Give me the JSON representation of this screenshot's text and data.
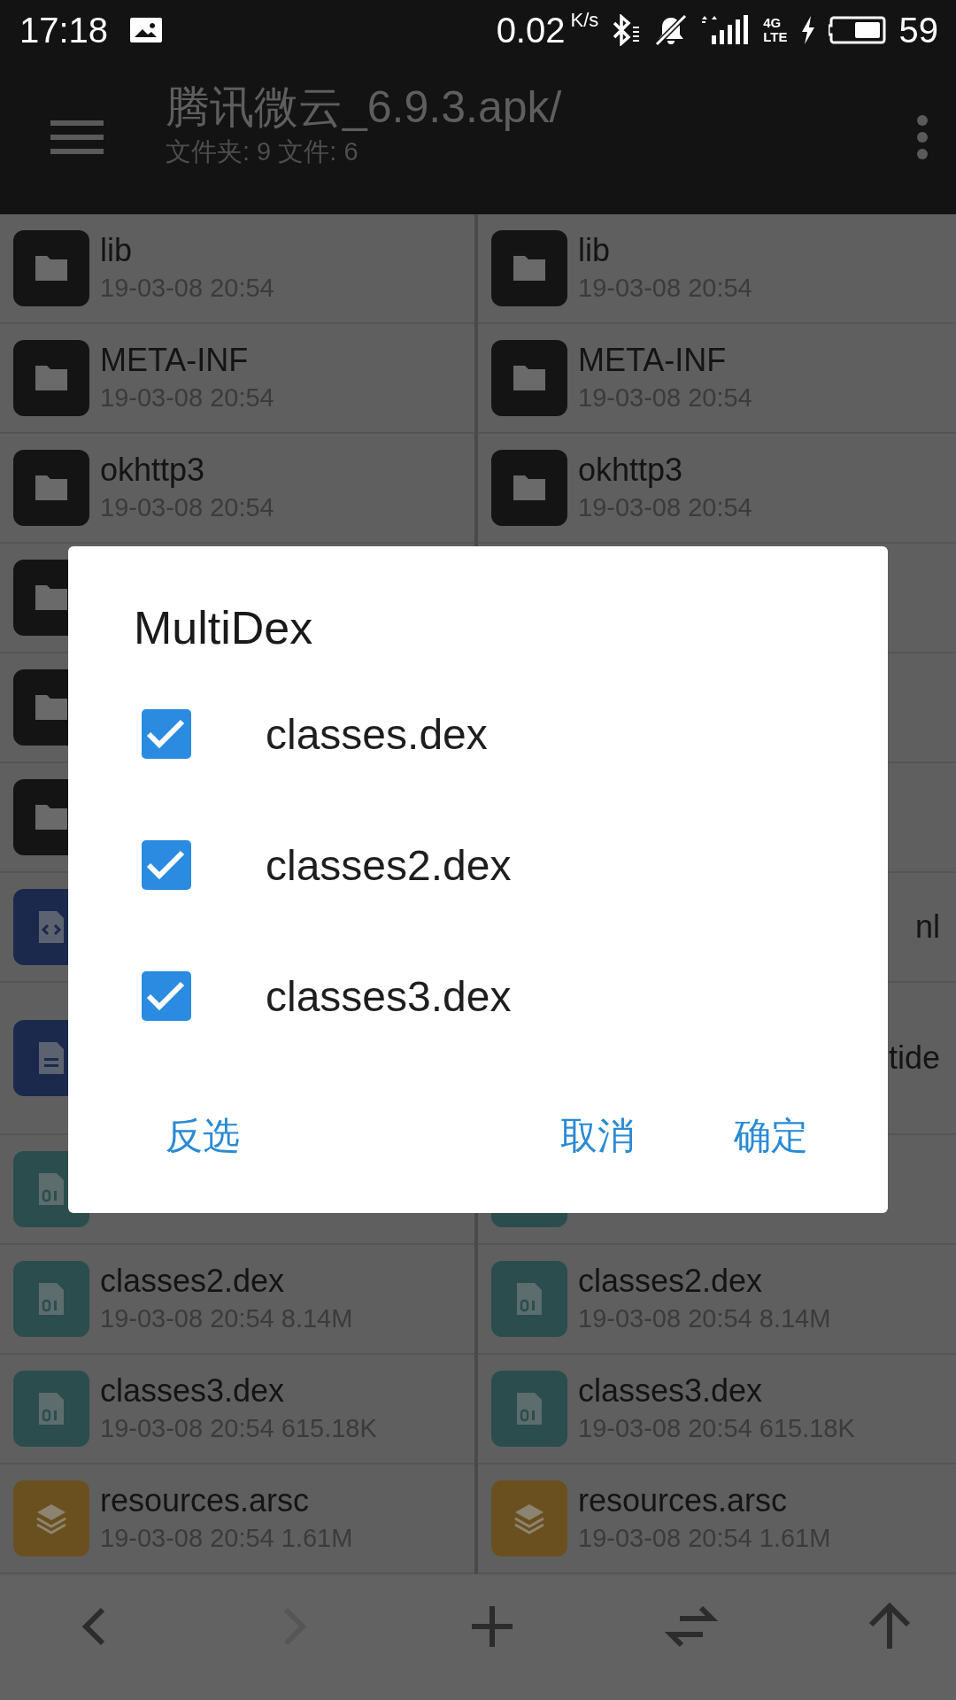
{
  "status_bar": {
    "time": "17:18",
    "speed": "0.02",
    "speed_unit": "K/s",
    "network": "4G",
    "network_sub": "LTE",
    "battery": "59"
  },
  "toolbar": {
    "title": "腾讯微云_6.9.3.apk/",
    "subtitle": "文件夹: 9  文件: 6"
  },
  "panes": [
    {
      "rows": [
        {
          "kind": "folder",
          "name": "lib",
          "date": "19-03-08 20:54"
        },
        {
          "kind": "folder",
          "name": "META-INF",
          "date": "19-03-08 20:54"
        },
        {
          "kind": "folder",
          "name": "okhttp3",
          "date": "19-03-08 20:54"
        },
        {
          "kind": "folder"
        },
        {
          "kind": "folder"
        },
        {
          "kind": "folder"
        },
        {
          "kind": "xml"
        },
        {
          "kind": "doc"
        },
        {
          "kind": "dex"
        },
        {
          "kind": "dex",
          "name": "classes2.dex",
          "date": "19-03-08 20:54  8.14M"
        },
        {
          "kind": "dex",
          "name": "classes3.dex",
          "date": "19-03-08 20:54  615.18K"
        },
        {
          "kind": "res",
          "name": "resources.arsc",
          "date": "19-03-08 20:54  1.61M"
        }
      ]
    },
    {
      "rows": [
        {
          "kind": "folder",
          "name": "lib",
          "date": "19-03-08 20:54"
        },
        {
          "kind": "folder",
          "name": "META-INF",
          "date": "19-03-08 20:54"
        },
        {
          "kind": "folder",
          "name": "okhttp3",
          "date": "19-03-08 20:54"
        },
        {
          "kind": "blank"
        },
        {
          "kind": "blank"
        },
        {
          "kind": "blank"
        },
        {
          "kind": "blank",
          "name": "nl"
        },
        {
          "kind": "blank",
          "name": "tide"
        },
        {
          "kind": "dex"
        },
        {
          "kind": "dex",
          "name": "classes2.dex",
          "date": "19-03-08 20:54  8.14M"
        },
        {
          "kind": "dex",
          "name": "classes3.dex",
          "date": "19-03-08 20:54  615.18K"
        },
        {
          "kind": "res",
          "name": "resources.arsc",
          "date": "19-03-08 20:54  1.61M"
        }
      ]
    }
  ],
  "dialog": {
    "title": "MultiDex",
    "options": [
      {
        "label": "classes.dex",
        "checked": true
      },
      {
        "label": "classes2.dex",
        "checked": true
      },
      {
        "label": "classes3.dex",
        "checked": true
      }
    ],
    "left_button": "反选",
    "buttons": [
      "取消",
      "确定"
    ]
  },
  "bottom_bar": [
    {
      "kind": "back",
      "disabled": false
    },
    {
      "kind": "forward",
      "disabled": true
    },
    {
      "kind": "add",
      "disabled": false
    },
    {
      "kind": "swap",
      "disabled": false
    },
    {
      "kind": "up",
      "disabled": false
    }
  ]
}
